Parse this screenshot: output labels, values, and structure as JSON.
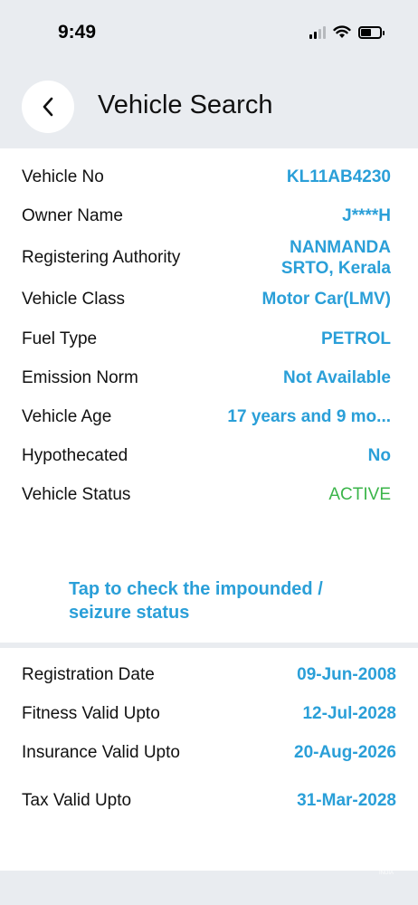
{
  "status_bar": {
    "time": "9:49"
  },
  "header": {
    "title": "Vehicle Search"
  },
  "details": [
    {
      "label": "Vehicle No",
      "value": "KL11AB4230"
    },
    {
      "label": "Owner Name",
      "value": "J****H"
    },
    {
      "label": "Registering Authority",
      "value": "NANMANDA\nSRTO, Kerala"
    },
    {
      "label": "Vehicle Class",
      "value": "Motor Car(LMV)"
    },
    {
      "label": "Fuel Type",
      "value": "PETROL"
    },
    {
      "label": "Emission Norm",
      "value": "Not Available"
    },
    {
      "label": "Vehicle Age",
      "value": "17 years and 9 mo..."
    },
    {
      "label": "Hypothecated",
      "value": "No"
    },
    {
      "label": "Vehicle Status",
      "value": "ACTIVE"
    }
  ],
  "impound_link": "Tap to check the impounded / seizure status",
  "validity": [
    {
      "label": "Registration Date",
      "value": "09-Jun-2008"
    },
    {
      "label": "Fitness Valid Upto",
      "value": "12-Jul-2028"
    },
    {
      "label": "Insurance Valid Upto",
      "value": "20-Aug-2026"
    },
    {
      "label": "Tax Valid Upto",
      "value": "31-Mar-2028"
    }
  ],
  "watermark": {
    "text": "olx",
    "sub": "INDIA"
  },
  "colors": {
    "accent": "#2a9fd8",
    "active": "#3bb54a",
    "background": "#e9ecf0"
  }
}
